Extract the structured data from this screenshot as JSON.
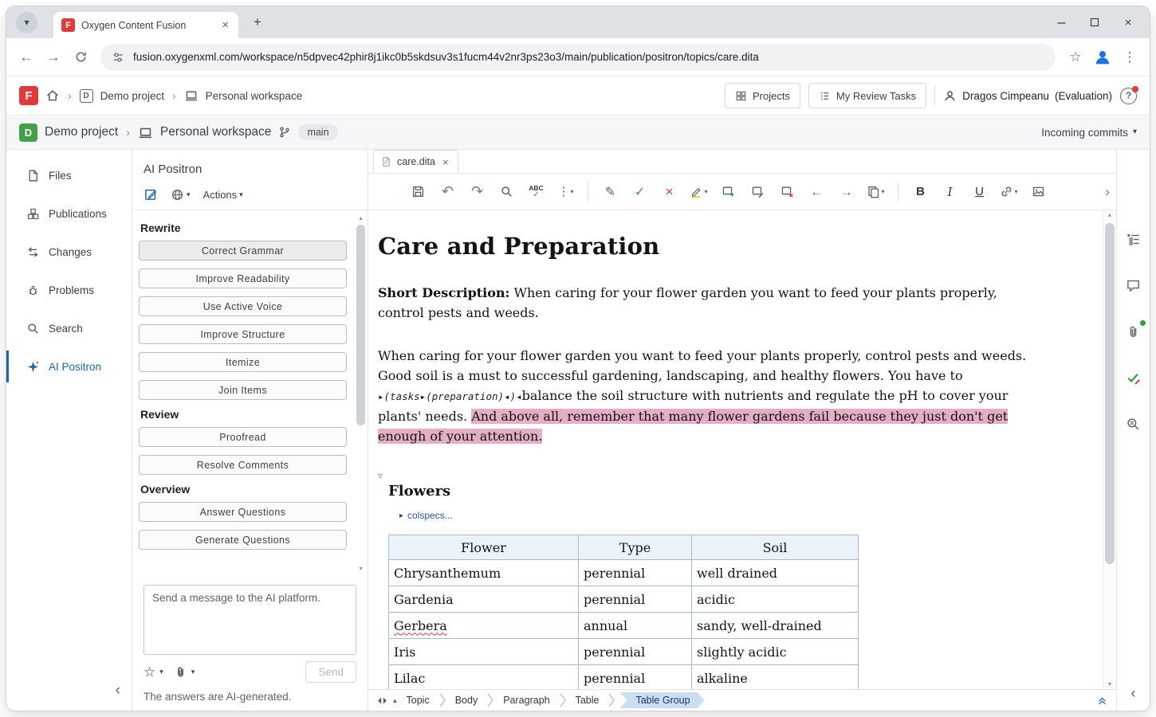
{
  "icons": {
    "chevron_down": "▾",
    "triangle_up": "▴",
    "triangle_down": "▾",
    "close": "×",
    "plus": "+",
    "back": "←",
    "forward": "→",
    "undo": "↶",
    "redo": "↷",
    "kebab": "⋮",
    "star": "☆",
    "sep": "›",
    "collapse_left": "‹",
    "expand_right": "›",
    "pencil": "✎",
    "check": "✓",
    "cross": "×",
    "help": "?",
    "section_collapse": "▿",
    "colspecs_triangle": "▸"
  },
  "brand": {
    "initial": "F"
  },
  "browser": {
    "tab_title": "Oxygen Content Fusion",
    "url": "fusion.oxygenxml.com/workspace/n5dpvec42phir8j1ikc0b5skdsuv3s1fucm44v2nr3ps23o3/main/publication/positron/topics/care.dita"
  },
  "header": {
    "project": "Demo project",
    "project_initial": "D",
    "workspace": "Personal workspace",
    "projects_label": "Projects",
    "review_tasks_label": "My Review Tasks",
    "user_name": "Dragos Cimpeanu",
    "user_badge": "(Evaluation)"
  },
  "workspace_bar": {
    "project": "Demo project",
    "project_initial": "D",
    "workspace": "Personal workspace",
    "branch": "main",
    "incoming_commits": "Incoming commits"
  },
  "sidebar": {
    "items": [
      {
        "label": "Files"
      },
      {
        "label": "Publications"
      },
      {
        "label": "Changes"
      },
      {
        "label": "Problems"
      },
      {
        "label": "Search"
      },
      {
        "label": "AI Positron"
      }
    ]
  },
  "ai_panel": {
    "title": "AI Positron",
    "actions_label": "Actions",
    "groups": [
      {
        "title": "Rewrite",
        "buttons": [
          "Correct Grammar",
          "Improve Readability",
          "Use Active Voice",
          "Improve Structure",
          "Itemize",
          "Join Items"
        ]
      },
      {
        "title": "Review",
        "buttons": [
          "Proofread",
          "Resolve Comments"
        ]
      },
      {
        "title": "Overview",
        "buttons": [
          "Answer Questions",
          "Generate Questions"
        ]
      }
    ],
    "message_placeholder": "Send a message to the AI platform.",
    "send_label": "Send",
    "footer_note": "The answers are AI-generated."
  },
  "editor": {
    "tab_label": "care.dita",
    "toolbar": {
      "spell": "ABC",
      "bold": "B",
      "italic": "I",
      "underline": "U"
    },
    "document": {
      "title": "Care and Preparation",
      "short_desc_label": "Short Description:",
      "short_desc_text": " When caring for your flower garden you want to feed your plants properly, control pests and weeds.",
      "body_before_marker": "When caring for your flower garden you want to feed your plants properly, control pests and weeds. Good soil is a must to successful gardening, landscaping, and healthy flowers. You have to ",
      "inline_marker": "▸(tasks▸(preparation)◂)◂",
      "body_after_marker": "balance the soil structure with nutrients and regulate the pH to cover your plants' needs. ",
      "inserted_text": "And above all, remember that many flower gardens fail because they just don't get enough of your attention.",
      "section_title": "Flowers",
      "colspecs_label": "colspecs...",
      "table": {
        "headers": [
          "Flower",
          "Type",
          "Soil"
        ],
        "rows": [
          [
            "Chrysanthemum",
            "perennial",
            "well drained"
          ],
          [
            "Gardenia",
            "perennial",
            "acidic"
          ],
          [
            "Gerbera",
            "annual",
            "sandy, well-drained"
          ],
          [
            "Iris",
            "perennial",
            "slightly acidic"
          ],
          [
            "Lilac",
            "perennial",
            "alkaline"
          ]
        ]
      }
    },
    "breadcrumb": [
      "Topic",
      "Body",
      "Paragraph",
      "Table",
      "Table Group"
    ]
  }
}
